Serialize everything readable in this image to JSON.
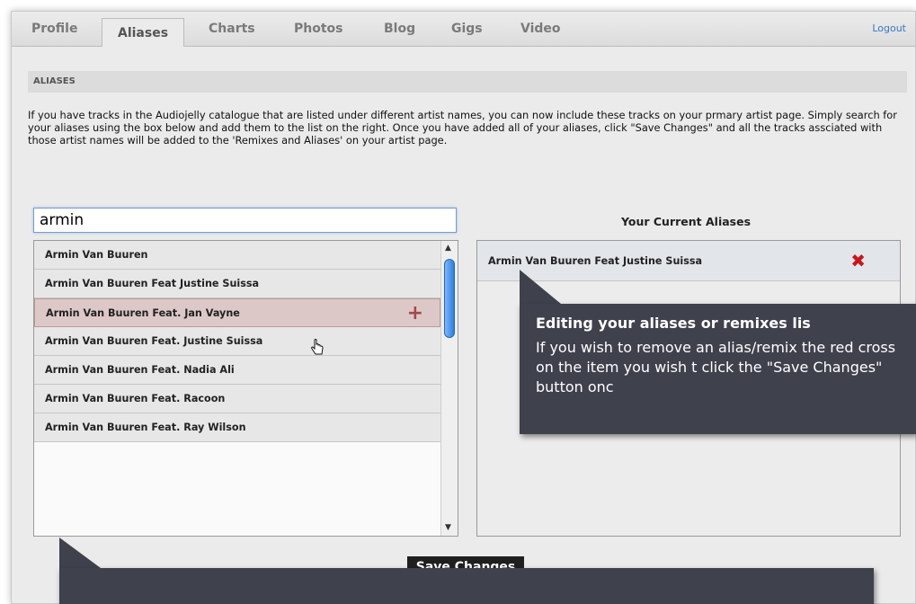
{
  "tabs": [
    "Profile",
    "Aliases",
    "Charts",
    "Photos",
    "Blog",
    "Gigs",
    "Video"
  ],
  "logout": "Logout",
  "section_title": "ALIASES",
  "intro": "If you have tracks in the Audiojelly catalogue that are listed under different artist names, you can now include these tracks on your prmary artist page. Simply search for your aliases using the box below and add them to the list on the right. Once you have added all of your aliases, click \"Save Changes\" and all the tracks assciated with those artist names will be added to the 'Remixes and Aliases' on your artist page.",
  "search": {
    "value": "armin"
  },
  "results": [
    "Armin Van Buuren",
    "Armin Van Buuren Feat Justine Suissa",
    "Armin Van Buuren Feat. Jan Vayne",
    "Armin Van Buuren Feat. Justine Suissa",
    "Armin Van Buuren Feat. Nadia Ali",
    "Armin Van Buuren Feat. Racoon",
    "Armin Van Buuren Feat. Ray Wilson"
  ],
  "add_symbol": "+",
  "current_title": "Your Current Aliases",
  "current_aliases": [
    "Armin Van Buuren Feat Justine Suissa"
  ],
  "remove_symbol": "✖",
  "save_label": "Save Changes",
  "tooltip": {
    "title": "Editing your aliases or remixes lis",
    "body": "If you wish to remove an alias/remix the red cross on the item you wish t click the \"Save Changes\" button onc"
  },
  "colors": {
    "accent": "#c8161d",
    "tooltip": "#3f424d",
    "scroll": "#2f7ed8"
  }
}
